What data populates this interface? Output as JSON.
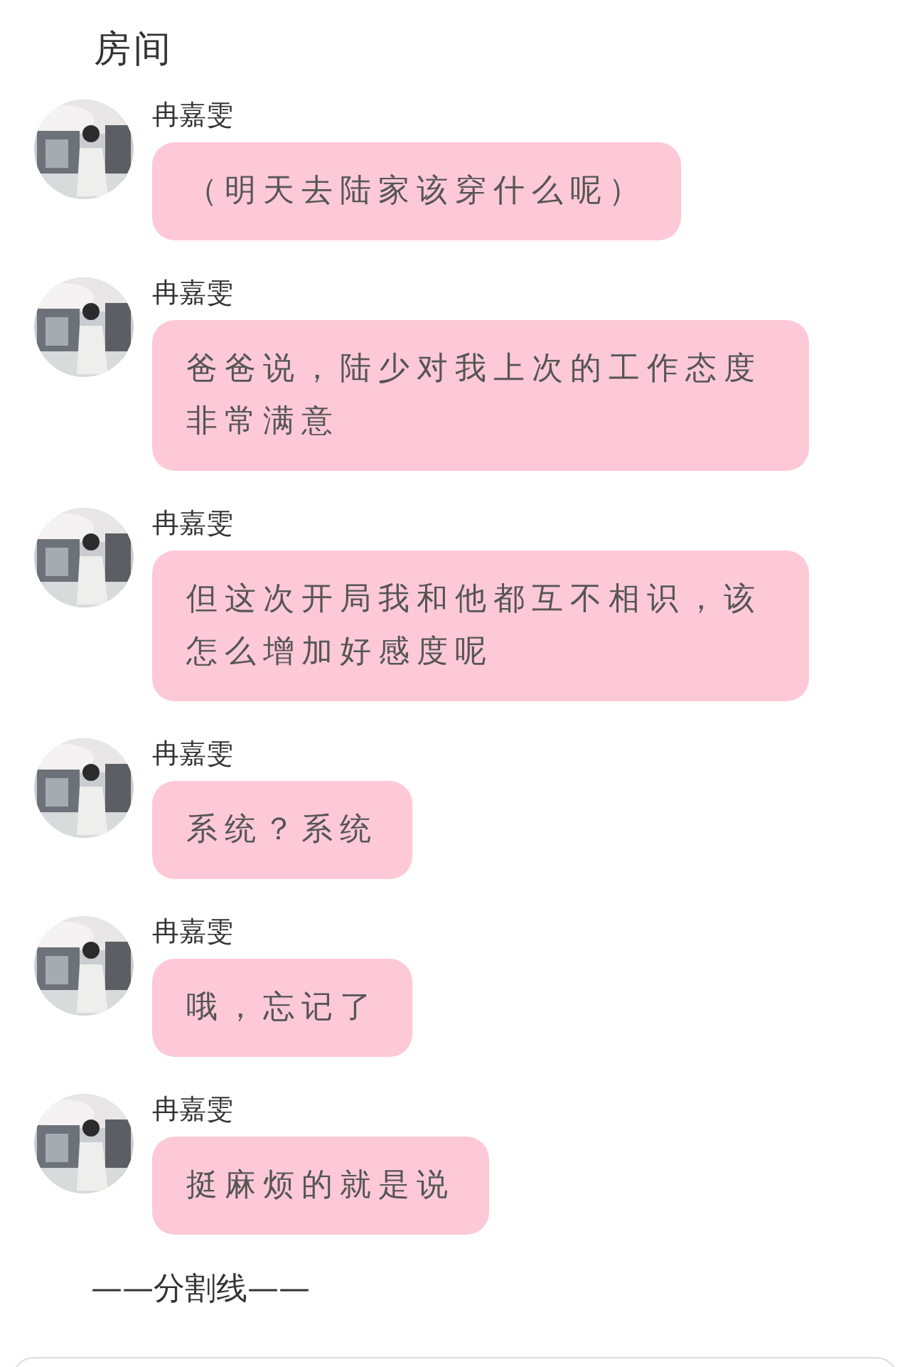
{
  "title": "房间",
  "messages": [
    {
      "sender": "冉嘉雯",
      "text": "（明天去陆家该穿什么呢）"
    },
    {
      "sender": "冉嘉雯",
      "text": "爸爸说，陆少对我上次的工作态度非常满意"
    },
    {
      "sender": "冉嘉雯",
      "text": "但这次开局我和他都互不相识，该怎么增加好感度呢"
    },
    {
      "sender": "冉嘉雯",
      "text": "系统？系统"
    },
    {
      "sender": "冉嘉雯",
      "text": "哦，忘记了"
    },
    {
      "sender": "冉嘉雯",
      "text": "挺麻烦的就是说"
    }
  ],
  "divider": "——分割线——"
}
